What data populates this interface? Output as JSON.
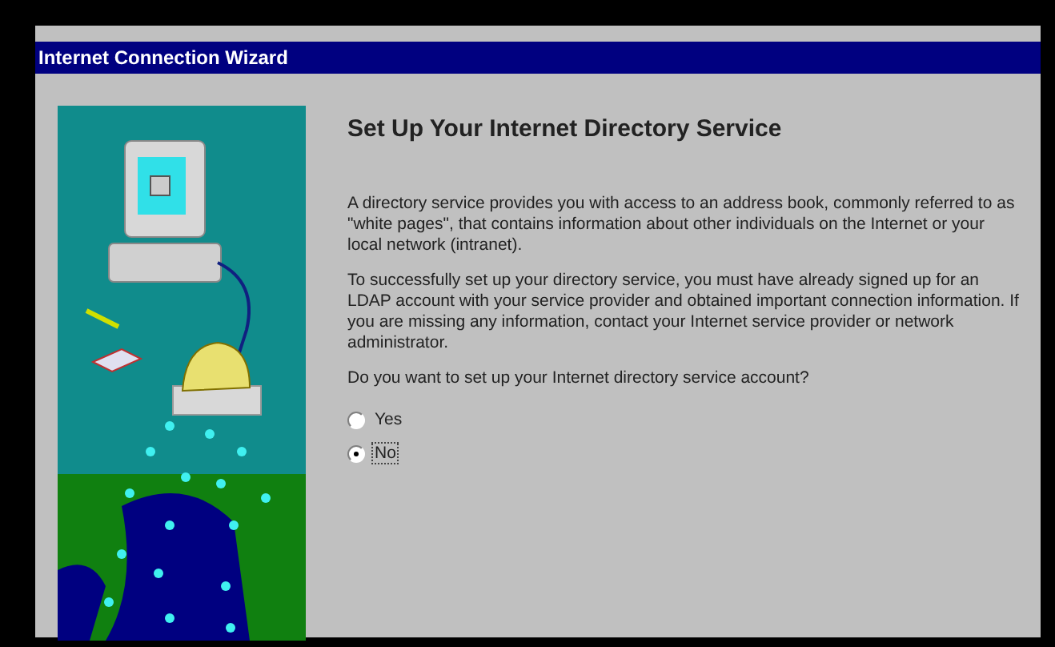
{
  "window": {
    "title": "Internet Connection Wizard"
  },
  "page": {
    "heading": "Set Up Your Internet Directory Service",
    "paragraphs": [
      "A directory service provides you with access to an address book, commonly referred to as \"white pages\", that contains information about other individuals on the Internet or your local network (intranet).",
      "To successfully set up your directory service, you must have already signed up for an LDAP account with your service provider and obtained important connection information. If you are missing any information, contact your Internet service provider or network administrator."
    ],
    "question": "Do you want to set up your Internet directory service account?",
    "options": [
      {
        "label": "Yes",
        "selected": false
      },
      {
        "label": "No",
        "selected": true
      }
    ]
  }
}
